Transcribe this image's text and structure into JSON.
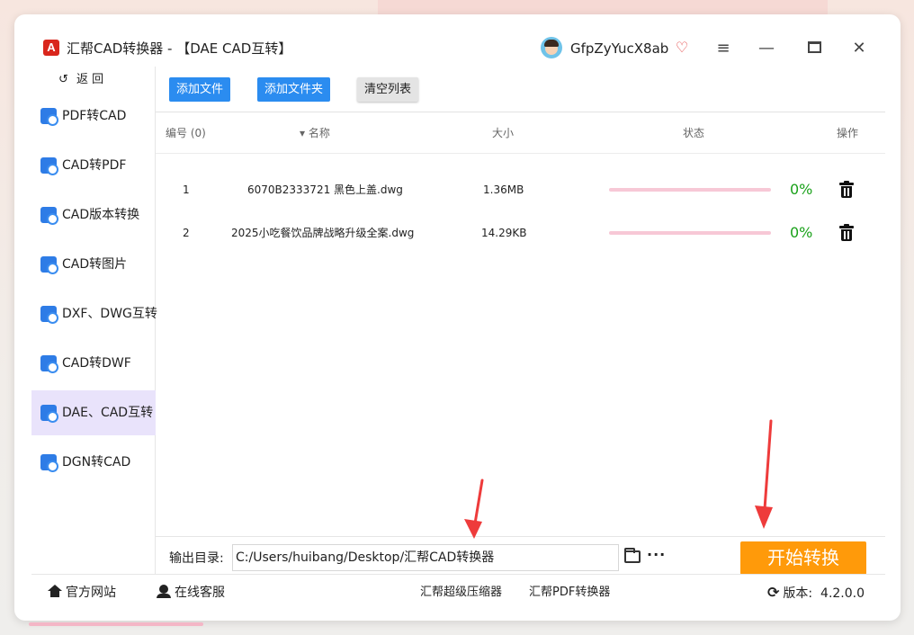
{
  "app": {
    "logo_letter": "A",
    "title": "汇帮CAD转换器 - 【DAE CAD互转】",
    "username": "GfpZyYucX8ab"
  },
  "window_controls": {
    "menu": "≡",
    "minimize": "—",
    "close": "✕"
  },
  "sidebar": {
    "back_arrow": "↺",
    "back_label": "返 回",
    "items": [
      {
        "label": "PDF转CAD",
        "active": false
      },
      {
        "label": "CAD转PDF",
        "active": false
      },
      {
        "label": "CAD版本转换",
        "active": false
      },
      {
        "label": "CAD转图片",
        "active": false
      },
      {
        "label": "DXF、DWG互转",
        "active": false
      },
      {
        "label": "CAD转DWF",
        "active": false
      },
      {
        "label": "DAE、CAD互转",
        "active": true
      },
      {
        "label": "DGN转CAD",
        "active": false
      }
    ]
  },
  "toolbar": {
    "add_file": "添加文件",
    "add_folder": "添加文件夹",
    "clear_list": "清空列表"
  },
  "table": {
    "headers": {
      "index": "编号 (0)",
      "name": "▾ 名称",
      "size": "大小",
      "status": "状态",
      "action": "操作"
    },
    "rows": [
      {
        "index": "1",
        "name": "6070B2333721 黑色上盖.dwg",
        "size": "1.36MB",
        "progress": 0,
        "percent": "0%"
      },
      {
        "index": "2",
        "name": "2025小吃餐饮品牌战略升级全案.dwg",
        "size": "14.29KB",
        "progress": 0,
        "percent": "0%"
      }
    ]
  },
  "output": {
    "label": "输出目录:",
    "path": "C:/Users/huibang/Desktop/汇帮CAD转换器",
    "more": "···"
  },
  "start_button": "开始转换",
  "footer": {
    "website": "官方网站",
    "service": "在线客服",
    "compressor": "汇帮超级压缩器",
    "pdf_converter": "汇帮PDF转换器",
    "version_label": "版本:",
    "version": "4.2.0.0",
    "refresh_glyph": "⟳"
  },
  "colors": {
    "accent_blue": "#2b8cf0",
    "start_orange": "#ff9a0a",
    "percent_green": "#1aa11a",
    "progress_pink": "#f7c8d6",
    "active_nav": "#e9e3fb",
    "annotation_arrow": "#ee3b3b"
  },
  "icons": {
    "app_logo": "app-logo-icon",
    "vip": "vip-diamond-icon",
    "trash": "trash-icon",
    "folder": "folder-icon",
    "home": "home-icon",
    "service": "customer-service-icon"
  }
}
